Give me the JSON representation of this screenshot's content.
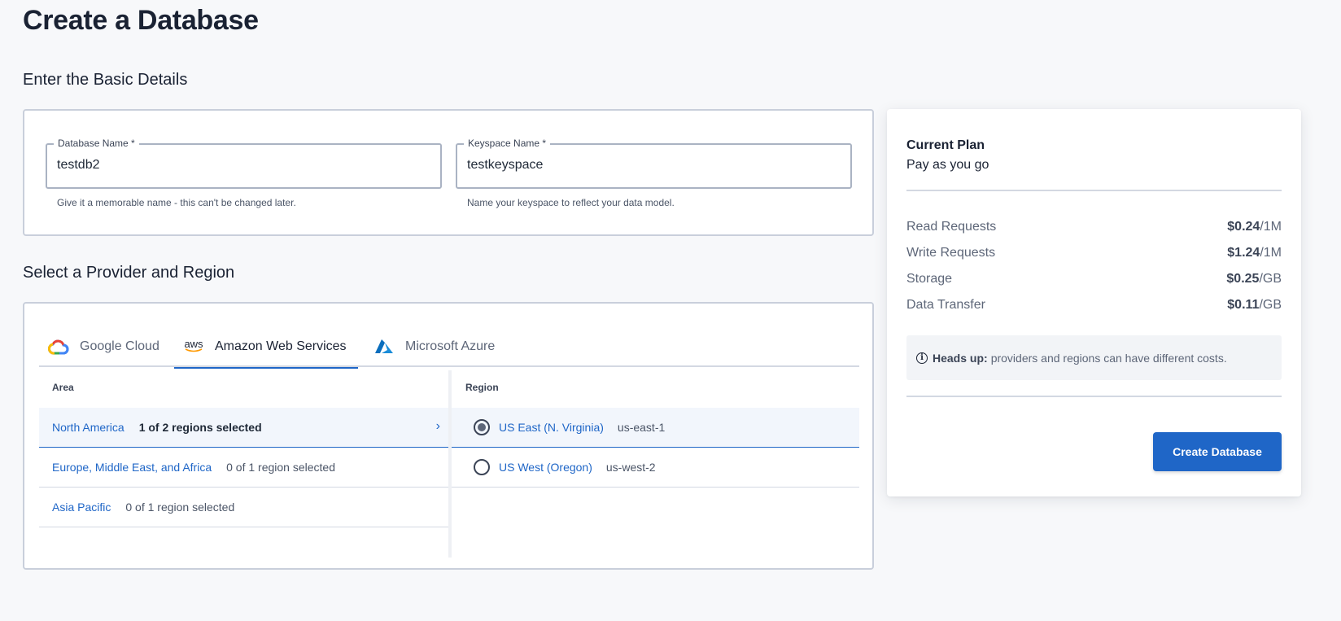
{
  "page": {
    "title": "Create a Database"
  },
  "basic_details": {
    "section_title": "Enter the Basic Details",
    "database_name": {
      "label": "Database Name *",
      "value": "testdb2",
      "helper": "Give it a memorable name - this can't be changed later."
    },
    "keyspace_name": {
      "label": "Keyspace Name *",
      "value": "testkeyspace",
      "helper": "Name your keyspace to reflect your data model."
    }
  },
  "provider_region": {
    "section_title": "Select a Provider and Region",
    "tabs": [
      {
        "label": "Google Cloud",
        "icon": "google-cloud-icon",
        "active": false
      },
      {
        "label": "Amazon Web Services",
        "icon": "aws-icon",
        "icon_text": "aws",
        "active": true
      },
      {
        "label": "Microsoft Azure",
        "icon": "azure-icon",
        "active": false
      }
    ],
    "area_header": "Area",
    "region_header": "Region",
    "areas": [
      {
        "name": "North America",
        "count": "1 of 2 regions selected",
        "selected": true
      },
      {
        "name": "Europe, Middle East, and Africa",
        "count": "0 of 1 region selected",
        "selected": false
      },
      {
        "name": "Asia Pacific",
        "count": "0 of 1 region selected",
        "selected": false
      }
    ],
    "regions": [
      {
        "name": "US East (N. Virginia)",
        "code": "us-east-1",
        "selected": true
      },
      {
        "name": "US West (Oregon)",
        "code": "us-west-2",
        "selected": false
      }
    ]
  },
  "plan": {
    "label": "Current Plan",
    "name": "Pay as you go",
    "prices": [
      {
        "label": "Read Requests",
        "value": "$0.24",
        "unit": "/1M"
      },
      {
        "label": "Write Requests",
        "value": "$1.24",
        "unit": "/1M"
      },
      {
        "label": "Storage",
        "value": "$0.25",
        "unit": "/GB"
      },
      {
        "label": "Data Transfer",
        "value": "$0.11",
        "unit": "/GB"
      }
    ],
    "notice": {
      "icon": "info-icon",
      "bold": "Heads up:",
      "text": "providers and regions can have different costs."
    },
    "create_button": "Create Database"
  },
  "colors": {
    "accent": "#1f66c7",
    "background": "#f7f8fa",
    "border": "#c9cfdb"
  }
}
